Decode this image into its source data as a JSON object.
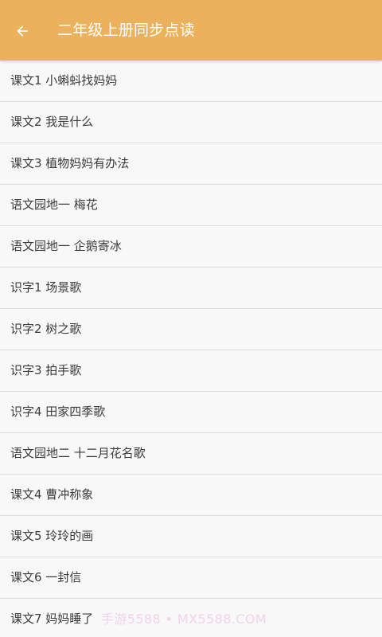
{
  "header": {
    "title": "二年级上册同步点读",
    "back_icon": "back-arrow-icon",
    "background_color": "#ebb15d"
  },
  "lessons": [
    {
      "label": "课文1 小蝌蚪找妈妈"
    },
    {
      "label": "课文2 我是什么"
    },
    {
      "label": "课文3 植物妈妈有办法"
    },
    {
      "label": "语文园地一 梅花"
    },
    {
      "label": "语文园地一 企鹅寄冰"
    },
    {
      "label": "识字1 场景歌"
    },
    {
      "label": "识字2 树之歌"
    },
    {
      "label": "识字3 拍手歌"
    },
    {
      "label": "识字4 田家四季歌"
    },
    {
      "label": "语文园地二 十二月花名歌"
    },
    {
      "label": "课文4 曹冲称象"
    },
    {
      "label": "课文5 玲玲的画"
    },
    {
      "label": "课文6 一封信"
    },
    {
      "label": "课文7 妈妈睡了"
    }
  ],
  "watermark": {
    "text": "手游5588 • MX5588.COM"
  }
}
